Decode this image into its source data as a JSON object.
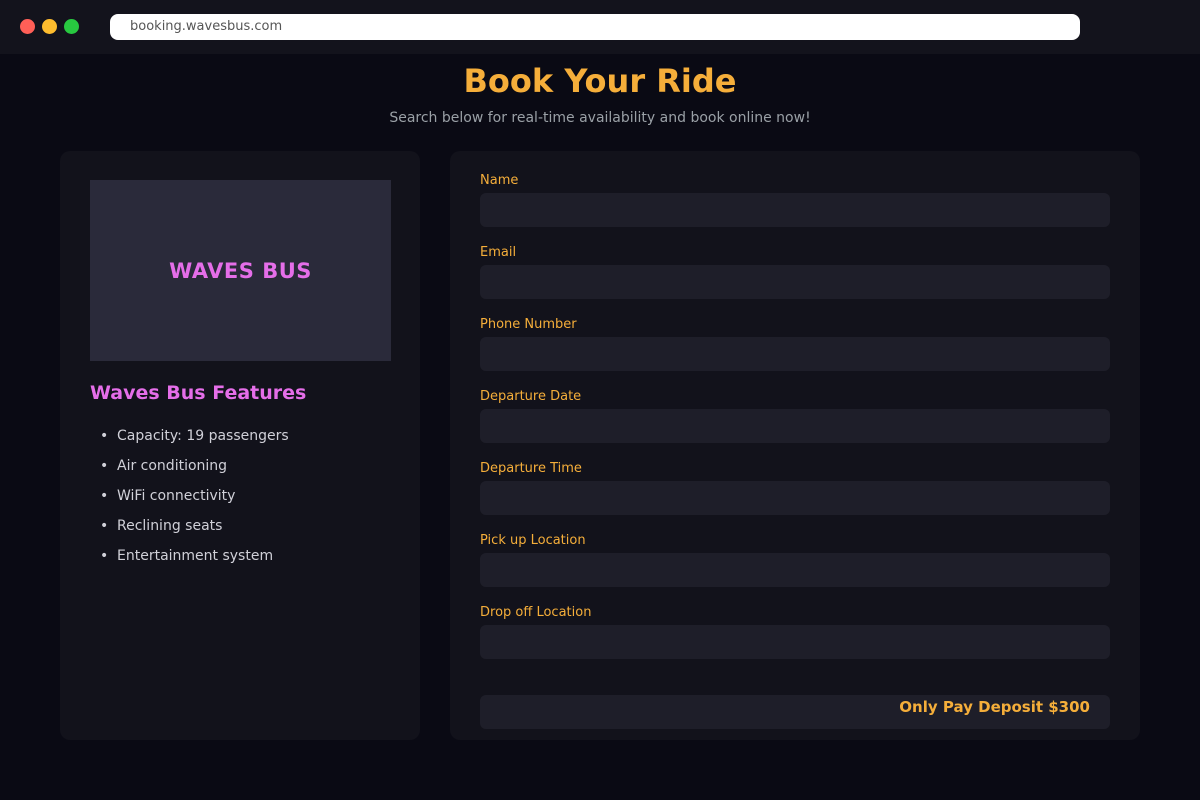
{
  "browser": {
    "url": "booking.wavesbus.com"
  },
  "header": {
    "title": "Book Your Ride",
    "subtitle": "Search below for real-time availability and book online now!"
  },
  "sidebar": {
    "logo_text": "WAVES BUS",
    "features_title": "Waves Bus Features",
    "features": [
      "Capacity: 19 passengers",
      "Air conditioning",
      "WiFi connectivity",
      "Reclining seats",
      "Entertainment system"
    ]
  },
  "form": {
    "fields": [
      {
        "label": "Name",
        "value": ""
      },
      {
        "label": "Email",
        "value": ""
      },
      {
        "label": "Phone Number",
        "value": ""
      },
      {
        "label": "Departure Date",
        "value": ""
      },
      {
        "label": "Departure Time",
        "value": ""
      },
      {
        "label": "Pick up Location",
        "value": ""
      },
      {
        "label": "Drop off Location",
        "value": ""
      }
    ],
    "deposit_text": "Only Pay Deposit $300"
  },
  "colors": {
    "accent": "#f5ae3a",
    "brand": "#e56ee9",
    "background": "#0a0a14",
    "panel": "#12121b"
  }
}
